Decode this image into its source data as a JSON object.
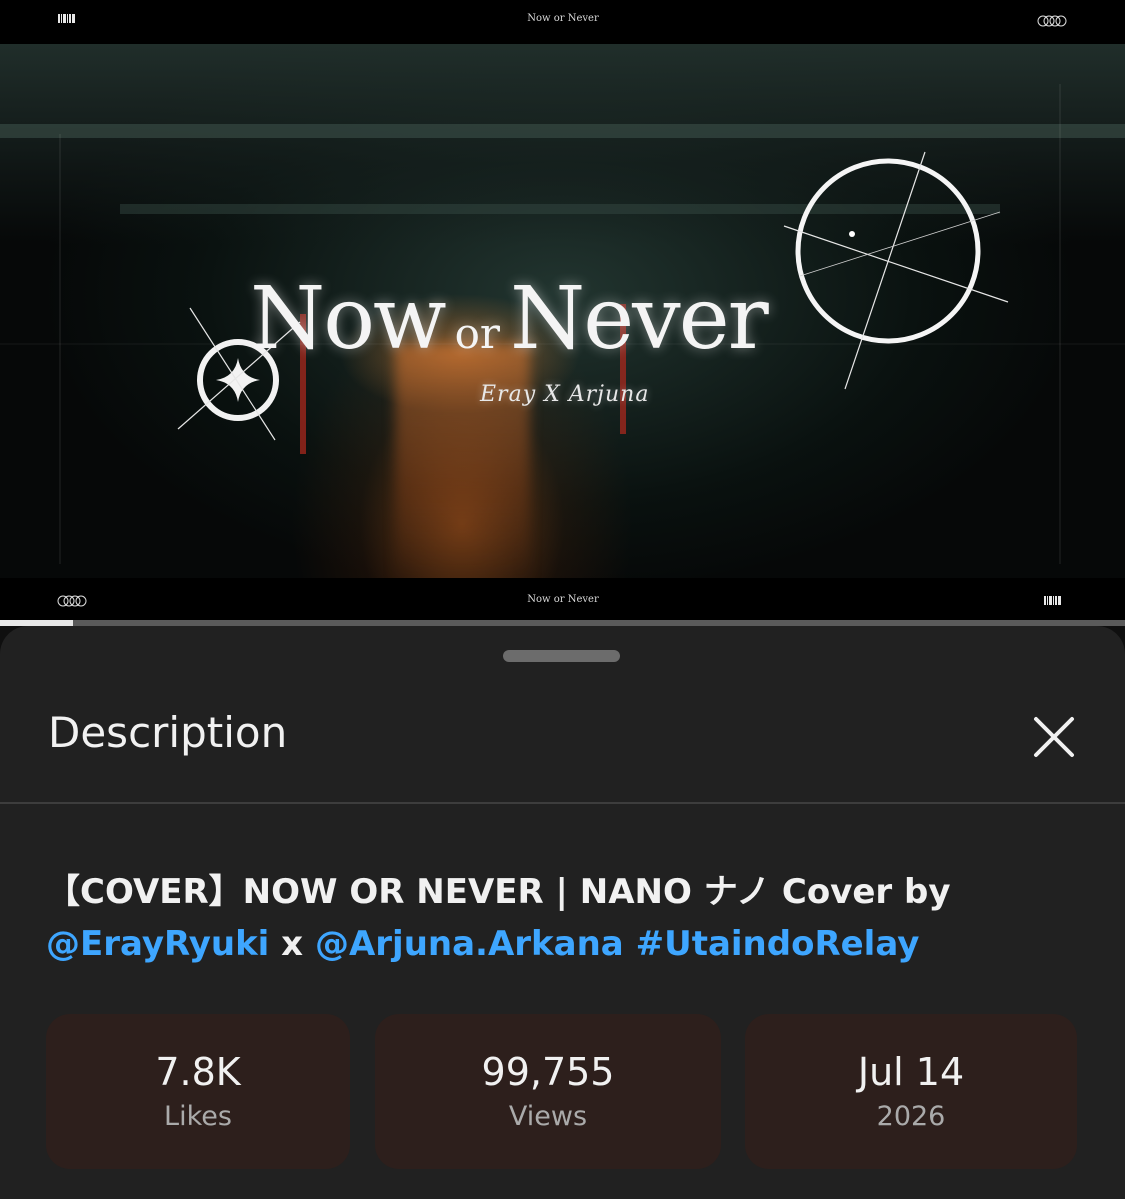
{
  "video": {
    "top_strip": {
      "center_title": "Now or Never"
    },
    "bottom_strip": {
      "center_title": "Now or Never"
    },
    "title_art": {
      "word1": "Now",
      "word2": "or",
      "word3": "Never",
      "subtitle": "Eray X Arjuna"
    },
    "progress_fraction": 0.065
  },
  "sheet": {
    "title": "Description",
    "close_icon": "close-icon"
  },
  "description": {
    "title_part1": "【COVER】NOW OR NEVER | NANO ナノ Cover by",
    "mention1": "@ErayRyuki",
    "separator": " x ",
    "mention2": "@Arjuna.Arkana",
    "hashtag": "#UtaindoRelay"
  },
  "stats": {
    "likes": {
      "value": "7.8K",
      "label": "Likes"
    },
    "views": {
      "value": "99,755",
      "label": "Views"
    },
    "date": {
      "value": "Jul 14",
      "label": "2026"
    }
  },
  "colors": {
    "sheet_bg": "#212121",
    "stat_bg": "#2d1f1c",
    "link": "#3ea6ff"
  }
}
